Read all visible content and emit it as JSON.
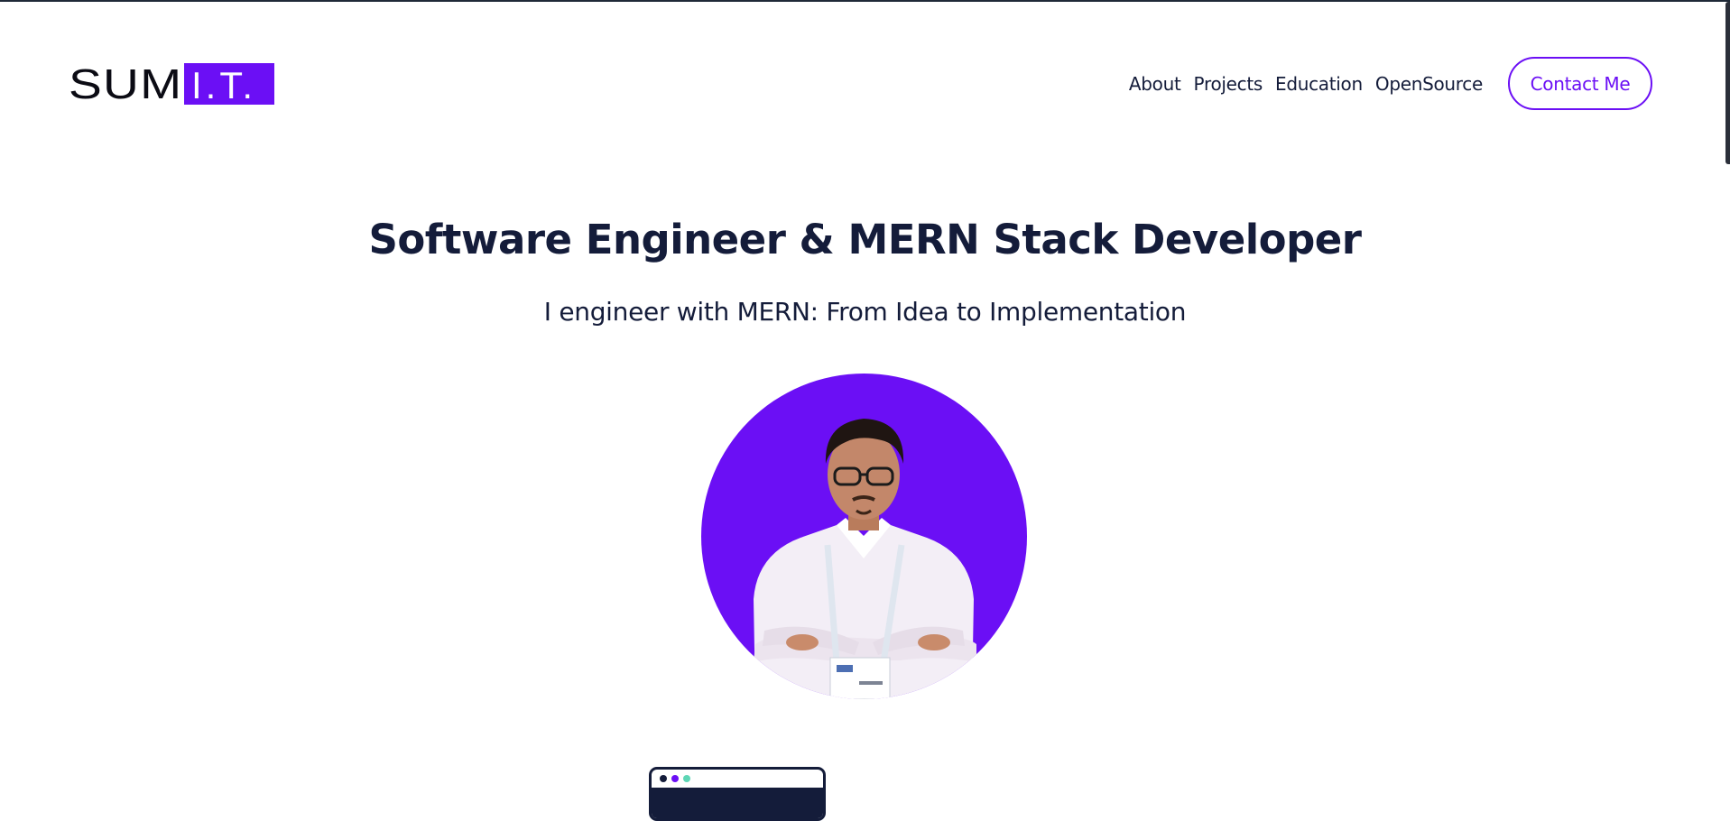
{
  "logo": {
    "plain": "SUM",
    "accent": "I.T."
  },
  "nav": {
    "links": [
      "About",
      "Projects",
      "Education",
      "OpenSource"
    ],
    "contact_label": "Contact Me"
  },
  "hero": {
    "title": "Software Engineer & MERN Stack Developer",
    "subtitle": "I engineer with MERN: From Idea to Implementation"
  },
  "colors": {
    "accent": "#6b0ff5",
    "text": "#141c3a",
    "background": "#ffffff",
    "dot_1": "#141c3a",
    "dot_2": "#6b0ff5",
    "dot_3": "#5ed6b5"
  },
  "icons": {
    "browser_dots": [
      "dot-dark",
      "dot-purple",
      "dot-teal"
    ]
  }
}
